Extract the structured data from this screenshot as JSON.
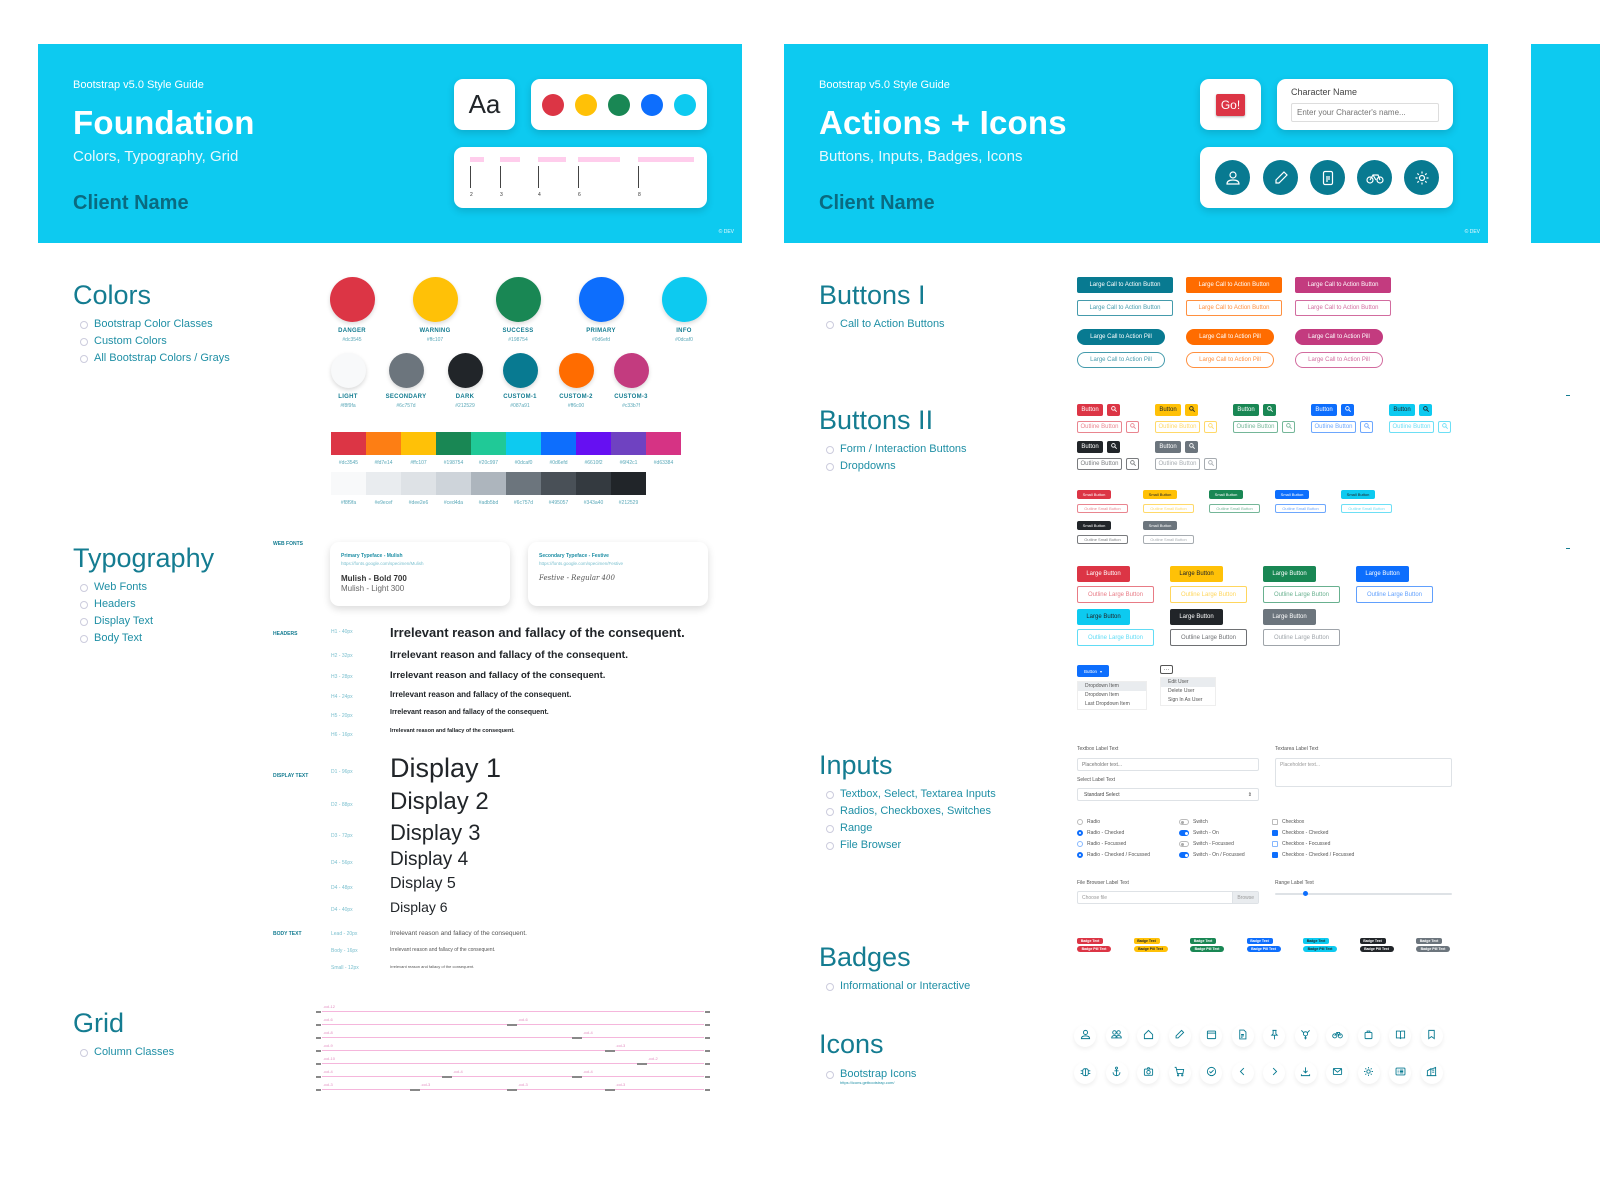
{
  "boards": {
    "foundation": {
      "hero": {
        "eyebrow": "Bootstrap v5.0 Style Guide",
        "title": "Foundation",
        "subtitle": "Colors, Typography, Grid",
        "client": "Client Name",
        "aa_label": "Aa",
        "hero_dots": [
          "#dc3545",
          "#ffc107",
          "#198754",
          "#0d6efd",
          "#0dcaf0"
        ],
        "grid_ticks": [
          "2",
          "3",
          "4",
          "6",
          "8"
        ],
        "credit": "© DEV"
      },
      "colors": {
        "title": "Colors",
        "bullets": [
          "Bootstrap Color Classes",
          "Custom Colors",
          "All Bootstrap Colors / Grays"
        ],
        "theme": [
          {
            "name": "DANGER",
            "hex": "#dc3545"
          },
          {
            "name": "WARNING",
            "hex": "#ffc107"
          },
          {
            "name": "SUCCESS",
            "hex": "#198754"
          },
          {
            "name": "PRIMARY",
            "hex": "#0d6efd"
          },
          {
            "name": "INFO",
            "hex": "#0dcaf0"
          }
        ],
        "extra": [
          {
            "name": "LIGHT",
            "hex": "#f8f9fa"
          },
          {
            "name": "SECONDARY",
            "hex": "#6c757d"
          },
          {
            "name": "DARK",
            "hex": "#212529"
          },
          {
            "name": "CUSTOM-1",
            "hex": "#087a91"
          },
          {
            "name": "CUSTOM-2",
            "hex": "#ff6c00"
          },
          {
            "name": "CUSTOM-3",
            "hex": "#c33b7f"
          }
        ],
        "all_colors": [
          "#dc3545",
          "#fd7e14",
          "#ffc107",
          "#198754",
          "#20c997",
          "#0dcaf0",
          "#0d6efd",
          "#6610f2",
          "#6f42c1",
          "#d63384"
        ],
        "grays": [
          "#f8f9fa",
          "#e9ecef",
          "#dee2e6",
          "#ced4da",
          "#adb5bd",
          "#6c757d",
          "#495057",
          "#343a40",
          "#212529"
        ]
      },
      "typography": {
        "title": "Typography",
        "bullets": [
          "Web Fonts",
          "Headers",
          "Display Text",
          "Body Text"
        ],
        "web_fonts_label": "WEB FONTS",
        "primary": {
          "label": "Primary Typeface - Mulish",
          "url": "https://fonts.google.com/specimen/Mulish",
          "bold": "Mulish - Bold 700",
          "light": "Mulish - Light 300"
        },
        "secondary": {
          "label": "Secondary Typeface - Festive",
          "url": "https://fonts.google.com/specimen/Festive",
          "sample": "Festive - Regular 400"
        },
        "headers_label": "HEADERS",
        "headers": [
          {
            "size": "H1 - 40px",
            "text": "Irrelevant reason and fallacy of the consequent."
          },
          {
            "size": "H2 - 32px",
            "text": "Irrelevant reason and fallacy of the consequent."
          },
          {
            "size": "H3 - 28px",
            "text": "Irrelevant reason and fallacy of the consequent."
          },
          {
            "size": "H4 - 24px",
            "text": "Irrelevant reason and fallacy of the consequent."
          },
          {
            "size": "H5 - 20px",
            "text": "Irrelevant reason and fallacy of the consequent."
          },
          {
            "size": "H6 - 16px",
            "text": "Irrelevant reason and fallacy of the consequent."
          }
        ],
        "display_label": "DISPLAY TEXT",
        "display": [
          {
            "size": "D1 - 96px",
            "text": "Display 1"
          },
          {
            "size": "D2 - 88px",
            "text": "Display 2"
          },
          {
            "size": "D3 - 72px",
            "text": "Display 3"
          },
          {
            "size": "D4 - 56px",
            "text": "Display 4"
          },
          {
            "size": "D4 - 48px",
            "text": "Display 5"
          },
          {
            "size": "D4 - 40px",
            "text": "Display 6"
          }
        ],
        "body_label": "BODY TEXT",
        "body": [
          {
            "size": "Lead - 20px",
            "text": "Irrelevant reason and fallacy of the consequent."
          },
          {
            "size": "Body - 16px",
            "text": "Irrelevant reason and fallacy of the consequent."
          },
          {
            "size": "Small - 12px",
            "text": "Irrelevant reason and fallacy of the consequent."
          }
        ]
      },
      "grid": {
        "title": "Grid",
        "bullets": [
          "Column Classes"
        ],
        "rows": [
          [
            ".col-12"
          ],
          [
            ".col-6",
            ".col-6"
          ],
          [
            ".col-8",
            ".col-4"
          ],
          [
            ".col-9",
            ".col-3"
          ],
          [
            ".col-10",
            ".col-2"
          ],
          [
            ".col-4",
            ".col-4",
            ".col-4"
          ],
          [
            ".col-3",
            ".col-3",
            ".col-3",
            ".col-3"
          ]
        ]
      }
    },
    "actions": {
      "hero": {
        "eyebrow": "Bootstrap v5.0 Style Guide",
        "title": "Actions + Icons",
        "subtitle": "Buttons, Inputs, Badges, Icons",
        "client": "Client Name",
        "go_label": "Go!",
        "char_label": "Character Name",
        "char_placeholder": "Enter your Character's name...",
        "credit": "© DEV"
      },
      "buttons1": {
        "title": "Buttons I",
        "bullets": [
          "Call to Action Buttons"
        ],
        "cta_label": "Large Call to Action Button",
        "pill_label": "Large Call to Action Pill",
        "colors": [
          "#087a91",
          "#ff6c00",
          "#c33b7f"
        ]
      },
      "buttons2": {
        "title": "Buttons II",
        "bullets": [
          "Form / Interaction Buttons",
          "Dropdowns"
        ],
        "btn_label": "Button",
        "outline_label": "Outline Button",
        "small_label": "Small Button",
        "outline_small_label": "Outline Small Button",
        "large_label": "Large Button",
        "outline_large_label": "Outline Large Button",
        "row1_colors": [
          "#dc3545",
          "#ffc107",
          "#198754",
          "#0d6efd",
          "#0dcaf0"
        ],
        "row2_colors": [
          "#212529",
          "#6c757d"
        ],
        "large_colors": [
          "#dc3545",
          "#ffc107",
          "#198754",
          "#0d6efd",
          "#0dcaf0",
          "#212529",
          "#6c757d"
        ],
        "dropdown": {
          "toggle": "Button",
          "items": [
            "Dropdown Item",
            "Dropdown Item",
            "Last Dropdown Item"
          ]
        },
        "kebab": {
          "toggle": "···",
          "items": [
            "Edit User",
            "Delete User",
            "Sign In As User"
          ]
        }
      },
      "inputs": {
        "title": "Inputs",
        "bullets": [
          "Textbox, Select, Textarea Inputs",
          "Radios, Checkboxes, Switches",
          "Range",
          "File Browser"
        ],
        "textbox_label": "Textbox Label Text",
        "textbox_placeholder": "Placeholder text...",
        "select_label": "Select Label Text",
        "select_value": "Standard Select",
        "textarea_label": "Textarea Label Text",
        "textarea_placeholder": "Placeholder text...",
        "radios": [
          "Radio",
          "Radio - Checked",
          "Radio - Focussed",
          "Radio - Checked / Focussed"
        ],
        "switches": [
          "Switch",
          "Switch - On",
          "Switch - Focussed",
          "Switch - On / Focussed"
        ],
        "checkboxes": [
          "Checkbox",
          "Checkbox - Checked",
          "Checkbox - Focussed",
          "Checkbox - Checked / Focussed"
        ],
        "file_label": "File Browser Label Text",
        "file_placeholder": "Choose file",
        "file_button": "Browse",
        "range_label": "Range Label Text",
        "range_value": 0.17
      },
      "badges": {
        "title": "Badges",
        "bullets": [
          "Informational or Interactive"
        ],
        "badge_label": "Badge Text",
        "pill_label": "Badge Pill Text",
        "colors": [
          "#dc3545",
          "#ffc107",
          "#198754",
          "#0d6efd",
          "#0dcaf0",
          "#212529",
          "#6c757d"
        ]
      },
      "icons": {
        "title": "Icons",
        "bullets": [
          "Bootstrap Icons"
        ],
        "link": "https://icons.getbootstrap.com/",
        "row1": [
          "person-icon",
          "people-icon",
          "house-icon",
          "pencil-icon",
          "calendar-icon",
          "file-text-icon",
          "pin-icon",
          "gender-trans-icon",
          "bicycle-icon",
          "bag-icon",
          "book-icon",
          "bookmark-icon"
        ],
        "row2": [
          "bug-icon",
          "anchor-icon",
          "camera-icon",
          "cart-icon",
          "check-circle-icon",
          "chevron-left-icon",
          "chevron-right-icon",
          "download-icon",
          "envelope-icon",
          "gear-icon",
          "card-list-icon",
          "building-icon"
        ]
      }
    }
  }
}
